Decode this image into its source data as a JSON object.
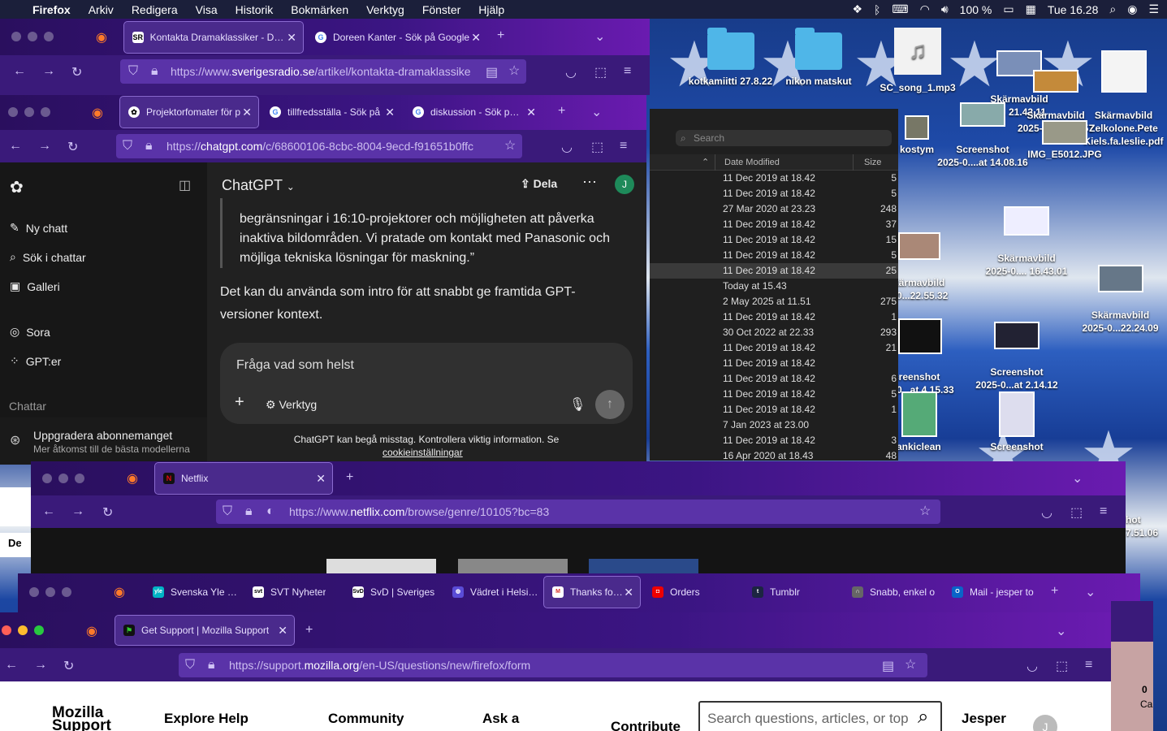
{
  "menubar": {
    "app": "Firefox",
    "items": [
      "Arkiv",
      "Redigera",
      "Visa",
      "Historik",
      "Bokmärken",
      "Verktyg",
      "Fönster",
      "Hjälp"
    ],
    "battery": "100 %",
    "clock": "Tue 16.28"
  },
  "desktop": {
    "icons": [
      {
        "label": "kotkamiitti 27.8.22"
      },
      {
        "label": "nikon matskut"
      },
      {
        "label": "SC_song_1.mp3"
      },
      {
        "label": "Skärmavbild\n...l. 21.42.11"
      },
      {
        "label": "Skärmavbild\n2025-07...2.53.57"
      },
      {
        "label": "Skärmavbild\nZelkolone.Pete\nKiels.fa.leslie.pdf"
      },
      {
        "label": "Screenshot\n2025-0....at 14.08.16"
      },
      {
        "label": "kostym"
      },
      {
        "label": "IMG_E5012.JPG"
      },
      {
        "label": "Skärmavbild\n2025-0.... 16.43.01"
      },
      {
        "label": "kärmavbild\n-0...22.55.32"
      },
      {
        "label": "Skärmavbild\n2025-0...22.24.09"
      },
      {
        "label": "creenshot\n-0...at 4.15.33"
      },
      {
        "label": "Screenshot\n2025-0...at 2.14.12"
      },
      {
        "label": "ankiclean"
      },
      {
        "label": "Screenshot"
      },
      {
        "label": "hot\n7.51.06"
      }
    ]
  },
  "finder": {
    "search_placeholder": "Search",
    "col_date": "Date Modified",
    "col_size": "Size",
    "rows": [
      {
        "date": "11 Dec 2019 at 18.42",
        "size": "5"
      },
      {
        "date": "11 Dec 2019 at 18.42",
        "size": "5"
      },
      {
        "date": "27 Mar 2020 at 23.23",
        "size": "248"
      },
      {
        "date": "11 Dec 2019 at 18.42",
        "size": "37"
      },
      {
        "date": "11 Dec 2019 at 18.42",
        "size": "15"
      },
      {
        "date": "11 Dec 2019 at 18.42",
        "size": "5"
      },
      {
        "date": "11 Dec 2019 at 18.42",
        "size": "25"
      },
      {
        "date": "Today at 15.43",
        "size": ""
      },
      {
        "date": "2 May 2025 at 11.51",
        "size": "275"
      },
      {
        "date": "11 Dec 2019 at 18.42",
        "size": "1"
      },
      {
        "date": "30 Oct 2022 at 22.33",
        "size": "293"
      },
      {
        "date": "11 Dec 2019 at 18.42",
        "size": "21"
      },
      {
        "date": "11 Dec 2019 at 18.42",
        "size": ""
      },
      {
        "date": "11 Dec 2019 at 18.42",
        "size": "6"
      },
      {
        "date": "11 Dec 2019 at 18.42",
        "size": "5"
      },
      {
        "date": "11 Dec 2019 at 18.42",
        "size": "1"
      },
      {
        "date": "7 Jan 2023 at 23.00",
        "size": ""
      },
      {
        "date": "11 Dec 2019 at 18.42",
        "size": "3"
      },
      {
        "date": "16 Apr 2020 at 18.43",
        "size": "48"
      }
    ]
  },
  "win1": {
    "tabs": [
      {
        "title": "Kontakta Dramaklassiker - Dram"
      },
      {
        "title": "Doreen Kanter - Sök på Google"
      }
    ],
    "url_pre": "https://www.",
    "url_host": "sverigesradio.se",
    "url_post": "/artikel/kontakta-dramaklassike"
  },
  "win2": {
    "tabs": [
      {
        "title": "Projektorfomater för p"
      },
      {
        "title": "tillfredsställa - Sök på"
      },
      {
        "title": "diskussion - Sök på G"
      }
    ],
    "url_pre": "https://",
    "url_host": "chatgpt.com",
    "url_post": "/c/68600106-8cbc-8004-9ecd-f91651b0ffc"
  },
  "chatgpt": {
    "sidebar": {
      "new_chat": "Ny chatt",
      "search": "Sök i chattar",
      "gallery": "Galleri",
      "sora": "Sora",
      "gpts": "GPT:er",
      "section": "Chattar",
      "upgrade_title": "Uppgradera abonnemanget",
      "upgrade_sub": "Mer åtkomst till de bästa modellerna"
    },
    "header": {
      "title": "ChatGPT",
      "share": "Dela",
      "avatar": "J"
    },
    "quote": "begränsningar i 16:10-projektorer och möjligheten att påverka inaktiva bildområden. Vi pratade om kontakt med Panasonic och möjliga tekniska lösningar för maskning.”",
    "reply": "Det kan du använda som intro för att snabbt ge framtida GPT-versioner kontext.",
    "composer": {
      "placeholder": "Fråga vad som helst",
      "tools": "Verktyg"
    },
    "footer_text": "ChatGPT kan begå misstag. Kontrollera viktig information. Se",
    "footer_link": "cookieinställningar"
  },
  "win3": {
    "tabs": [
      {
        "title": "Netflix"
      }
    ],
    "url_pre": "https://www.",
    "url_host": "netflix.com",
    "url_post": "/browse/genre/10105?bc=83"
  },
  "win4": {
    "tabs": [
      {
        "title": "Svenska Yle | N"
      },
      {
        "title": "SVT Nyheter"
      },
      {
        "title": "SvD | Sveriges"
      },
      {
        "title": "Vädret i Helsing"
      },
      {
        "title": "Thanks for c"
      },
      {
        "title": "Orders"
      },
      {
        "title": "Tumblr"
      },
      {
        "title": "Snabb, enkel o"
      },
      {
        "title": "Mail - jesper to"
      }
    ]
  },
  "win5": {
    "tabs": [
      {
        "title": "Get Support | Mozilla Support"
      }
    ],
    "url_pre": "https://support.",
    "url_host": "mozilla.org",
    "url_post": "/en-US/questions/new/firefox/form",
    "page": {
      "logo_line1": "Mozilla",
      "logo_line2": "Support",
      "nav": [
        "Explore Help",
        "Community",
        "Ask a",
        "Contribute"
      ],
      "search_placeholder": "Search questions, articles, or top",
      "user": "Jesper",
      "avatar": "J"
    }
  },
  "edge_fragments": {
    "left_label": "De",
    "right_text": "Ca",
    "right_num": "0"
  }
}
